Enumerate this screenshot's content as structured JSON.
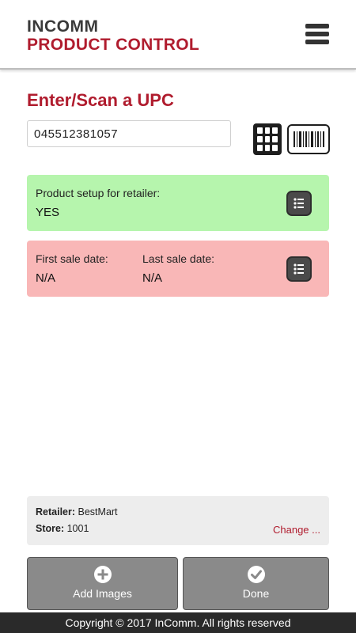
{
  "header": {
    "brand_line1": "INCOMM",
    "brand_line2": "PRODUCT CONTROL",
    "menu_icon": "hamburger-menu-icon"
  },
  "scan": {
    "title": "Enter/Scan a UPC",
    "upc_value": "045512381057",
    "keypad_icon": "keypad-icon",
    "barcode_icon": "barcode-icon"
  },
  "setup_card": {
    "label": "Product setup for retailer:",
    "value": "YES",
    "color": "#b6f5ad"
  },
  "sales_card": {
    "first_label": "First sale date:",
    "first_value": "N/A",
    "last_label": "Last sale date:",
    "last_value": "N/A",
    "color": "#f9b7b7"
  },
  "store_info": {
    "retailer_label": "Retailer:",
    "retailer_value": "BestMart",
    "store_label": "Store:",
    "store_value": "1001",
    "change_label": "Change ..."
  },
  "actions": {
    "add_images_label": "Add Images",
    "done_label": "Done"
  },
  "footer": {
    "copyright": "Copyright © 2017 InComm. All rights reserved"
  },
  "colors": {
    "brand_red": "#b01c2e",
    "brand_gray": "#3a3a3a"
  }
}
